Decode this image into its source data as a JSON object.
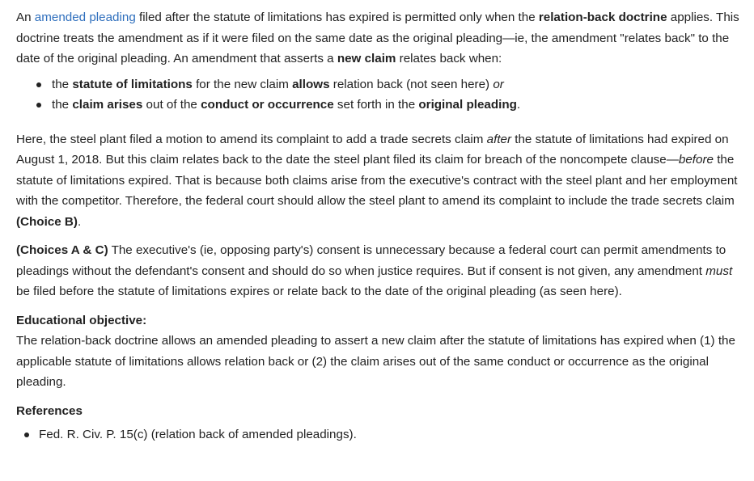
{
  "intro": {
    "link_text": "amended pleading",
    "s1": "An ",
    "s2": " filed after the statute of limitations has expired is permitted only when the ",
    "b1": "relation-back doctrine",
    "s3": " applies.  This doctrine treats the amendment as if it were filed on the same date as the original pleading—ie, the amendment \"relates back\" to the date of the original pleading.  An amendment that asserts a ",
    "b2": "new claim",
    "s4": " relates back when:"
  },
  "bullets": {
    "item1": {
      "s1": "the ",
      "b1": "statute of limitations",
      "s2": " for the new claim ",
      "b2": "allows",
      "s3": " relation back (not seen here) ",
      "i1": "or"
    },
    "item2": {
      "s1": "the ",
      "b1": "claim arises",
      "s2": " out of the ",
      "b2": "conduct or occurrence",
      "s3": " set forth in the ",
      "b3": "original pleading",
      "s4": "."
    }
  },
  "analysis": {
    "s1": "Here, the steel plant filed a motion to amend its complaint to add a trade secrets claim ",
    "i1": "after",
    "s2": " the statute of limitations had expired on August 1, 2018.  But this claim relates back to the date the steel plant filed its claim for breach of the noncompete clause—",
    "i2": "before",
    "s3": " the statute of limitations expired.  That is because both claims arise from the executive's contract with the steel plant and her employment with the competitor.  Therefore, the federal court should allow the steel plant to amend its complaint to include the trade secrets claim ",
    "b1": "(Choice B)",
    "s4": "."
  },
  "choices": {
    "b1": "(Choices A & C)",
    "s1": "  The executive's (ie, opposing party's) consent is unnecessary because a federal court can permit amendments to pleadings without the defendant's consent and should do so when justice requires.  But if consent is not given, any amendment ",
    "i1": "must",
    "s2": " be filed before the statute of limitations expires or relate back to the date of the original pleading (as seen here)."
  },
  "educational_objective": {
    "heading": "Educational objective:",
    "text": "The relation-back doctrine allows an amended pleading to assert a new claim after the statute of limitations has expired when (1) the applicable statute of limitations allows relation back or (2) the claim arises out of the same conduct or occurrence as the original pleading."
  },
  "references": {
    "heading": "References",
    "items": [
      "Fed. R. Civ. P. 15(c) (relation back of amended pleadings)."
    ]
  },
  "colors": {
    "text": "#222222",
    "link": "#2f6fbd",
    "background": "#ffffff"
  }
}
